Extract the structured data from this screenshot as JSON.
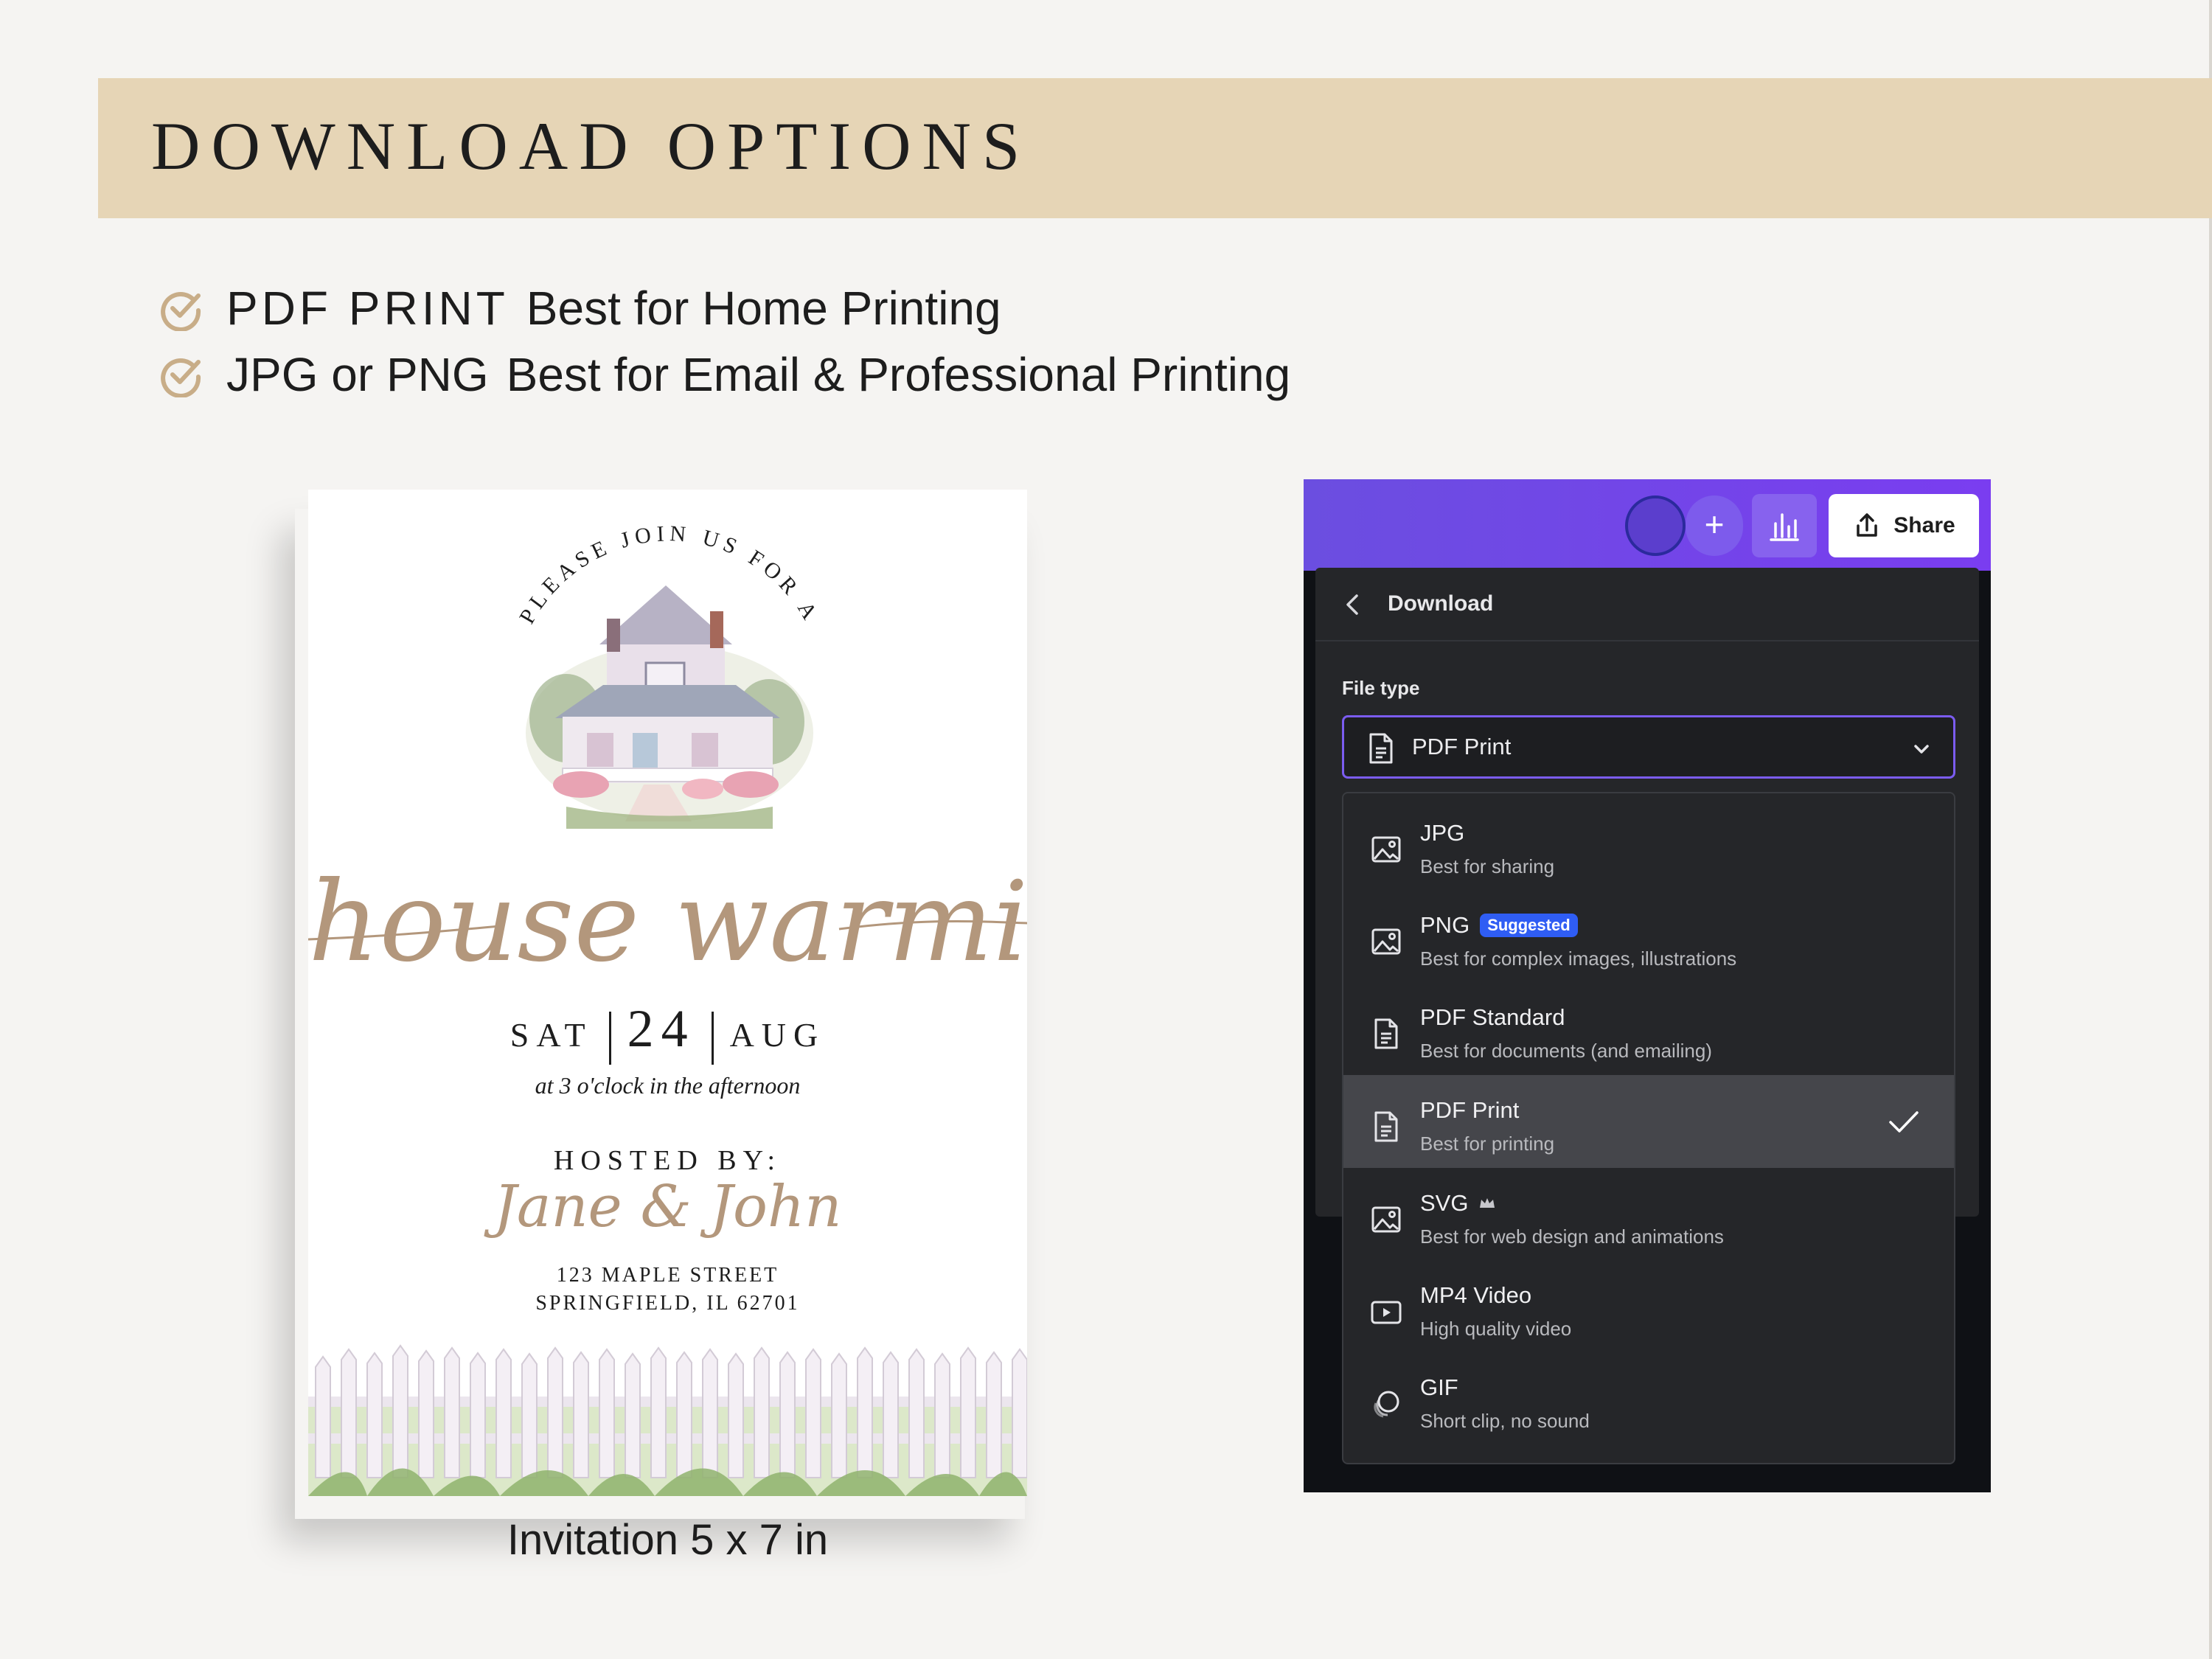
{
  "banner": {
    "title": "DOWNLOAD OPTIONS"
  },
  "options": [
    {
      "name": "PDF PRINT",
      "description": "Best for Home Printing"
    },
    {
      "name": "JPG or PNG",
      "description": "Best for Email & Professional Printing"
    }
  ],
  "invitation": {
    "arc_text": "PLEASE JOIN US FOR A",
    "script_title": "house warming",
    "date": {
      "weekday": "SAT",
      "day": "24",
      "month": "AUG"
    },
    "time": "at 3 o'clock in the afternoon",
    "hosted_by": "HOSTED BY:",
    "hosts": "Jane & John",
    "address_line1": "123 MAPLE STREET",
    "address_line2": "SPRINGFIELD, IL 62701",
    "caption": {
      "name": "Invitation",
      "size": "5 x 7 in"
    }
  },
  "canva": {
    "topbar": {
      "plus_label": "+",
      "share_label": "Share"
    },
    "download": {
      "title": "Download",
      "file_type_label": "File type",
      "selected_value": "PDF Print",
      "items": [
        {
          "name": "JPG",
          "description": "Best for sharing",
          "icon": "image-icon"
        },
        {
          "name": "PNG",
          "description": "Best for complex images, illustrations",
          "icon": "image-icon",
          "badge": "Suggested"
        },
        {
          "name": "PDF Standard",
          "description": "Best for documents (and emailing)",
          "icon": "document-icon"
        },
        {
          "name": "PDF Print",
          "description": "Best for printing",
          "icon": "document-icon",
          "selected": true
        },
        {
          "name": "SVG",
          "description": "Best for web design and animations",
          "icon": "image-icon",
          "premium": true
        },
        {
          "name": "MP4 Video",
          "description": "High quality video",
          "icon": "video-icon"
        },
        {
          "name": "GIF",
          "description": "Short clip, no sound",
          "icon": "gif-icon"
        }
      ]
    }
  },
  "colors": {
    "banner": "#e6d5b6",
    "accent_gold": "#c8ad88",
    "canva_purple": "#7b5cf0",
    "badge_blue": "#2f5df4"
  }
}
